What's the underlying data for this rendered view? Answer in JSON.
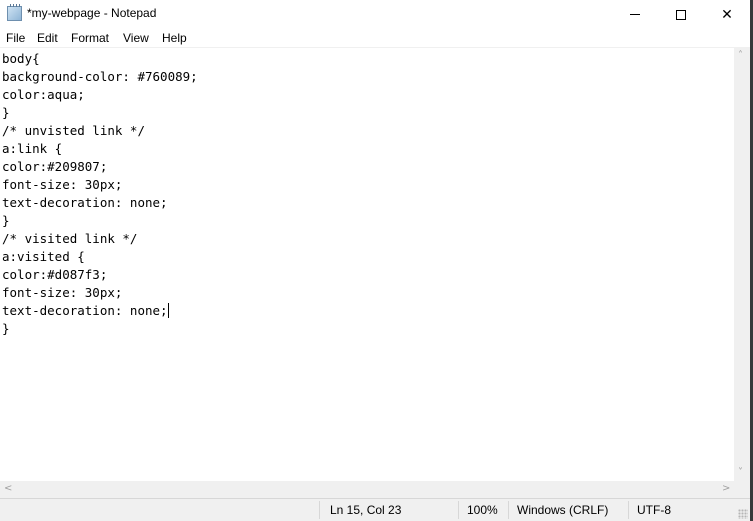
{
  "window": {
    "title": "*my-webpage - Notepad",
    "controls": {
      "minimize": "minimize",
      "maximize": "maximize",
      "close": "close"
    }
  },
  "menu": [
    "File",
    "Edit",
    "Format",
    "View",
    "Help"
  ],
  "editor": {
    "lines": [
      "body{",
      "background-color: #760089;",
      "color:aqua;",
      "}",
      "/* unvisted link */",
      "a:link {",
      "color:#209807;",
      "font-size: 30px;",
      "text-decoration: none;",
      "}",
      "/* visited link */",
      "a:visited {",
      "color:#d087f3;",
      "font-size: 30px;",
      "text-decoration: none;",
      "}"
    ],
    "caret_line": 15,
    "caret_col": 23
  },
  "status": {
    "position": "Ln 15, Col 23",
    "zoom": "100%",
    "line_ending": "Windows (CRLF)",
    "encoding": "UTF-8"
  },
  "icons": {
    "app": "notepad-icon",
    "scroll_up": "˄",
    "scroll_down": "˅",
    "scroll_left": "<",
    "scroll_right": ">",
    "close": "✕"
  }
}
